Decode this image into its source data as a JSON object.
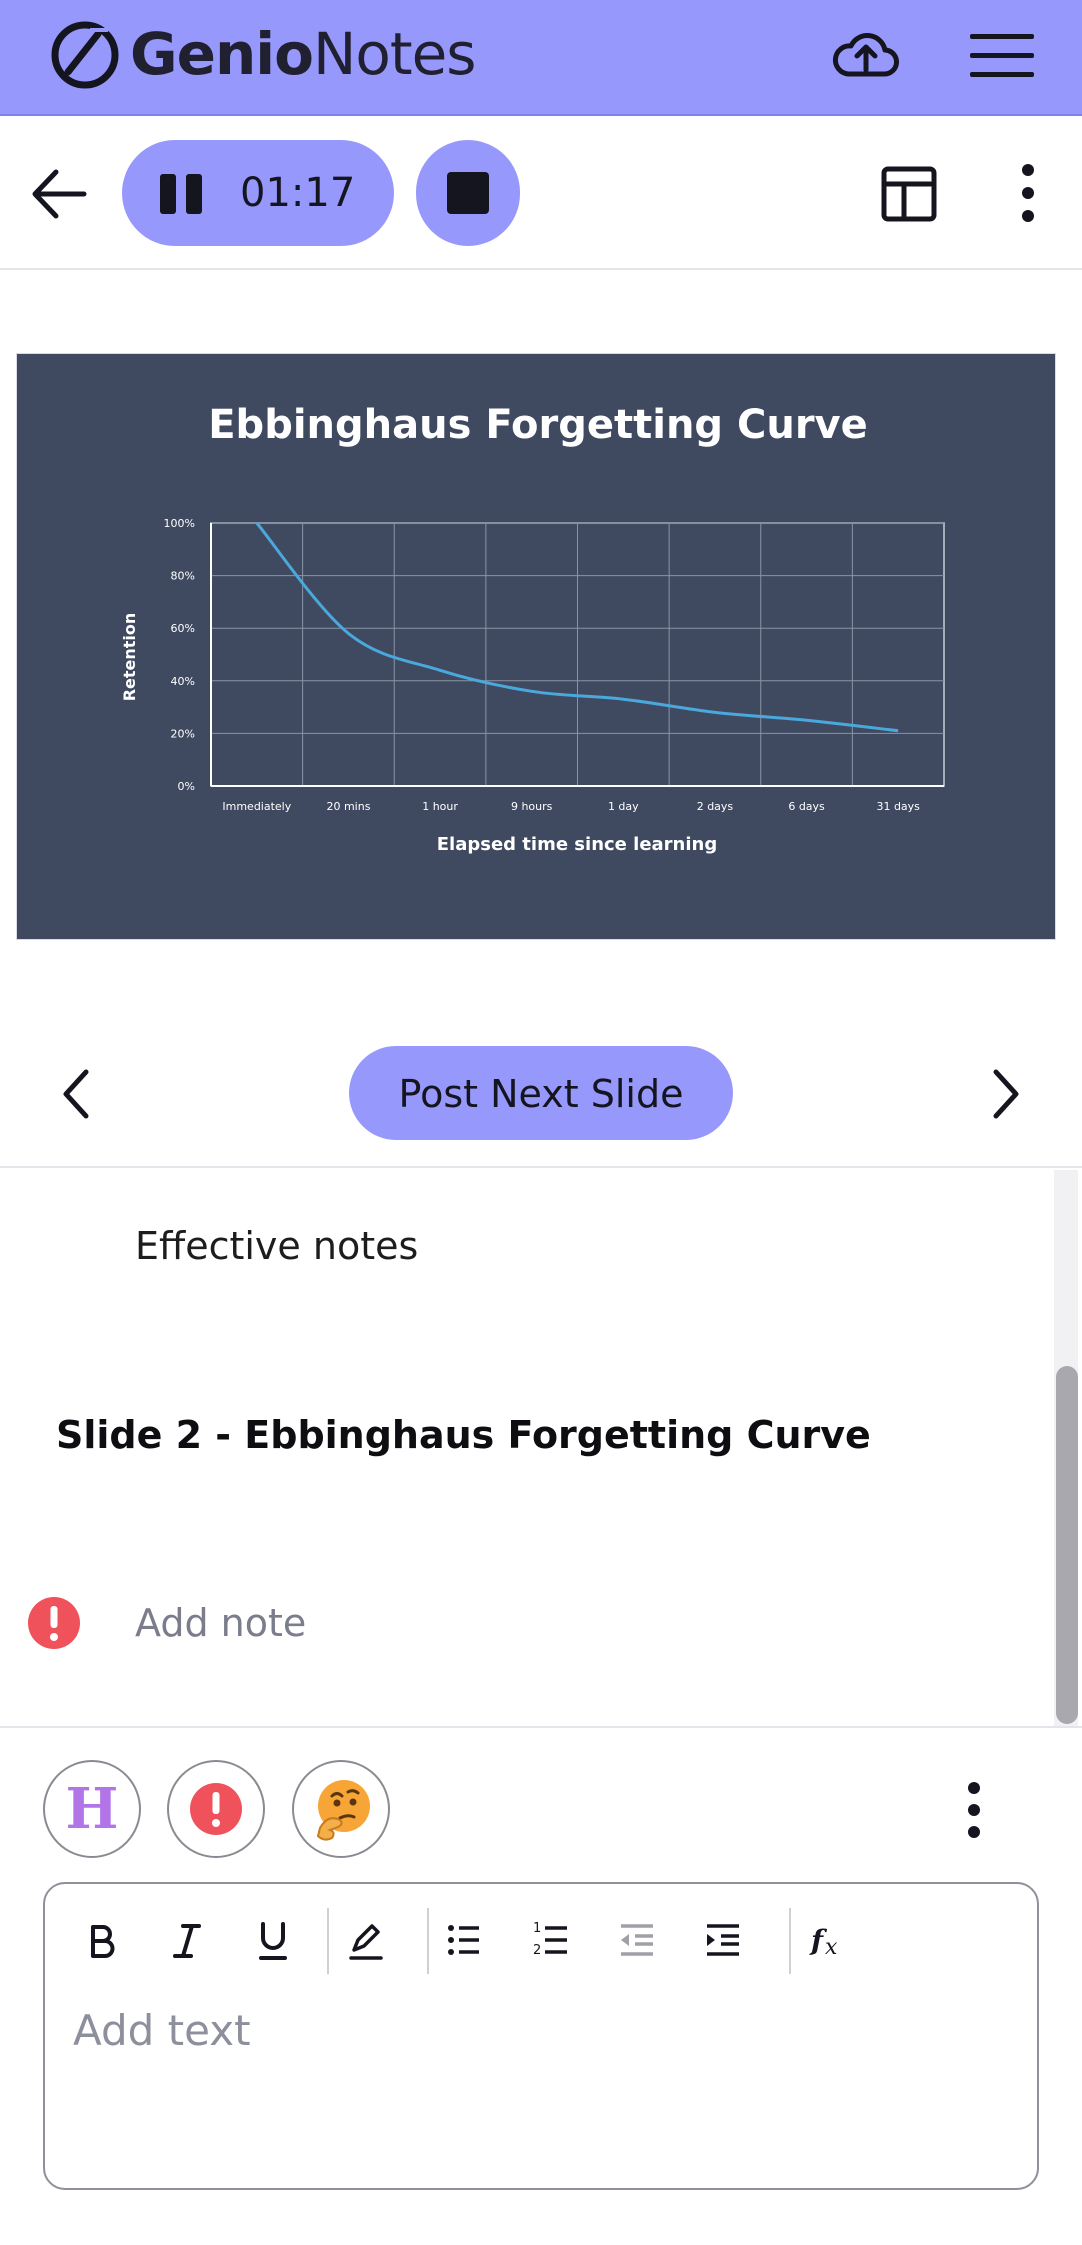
{
  "app": {
    "name_bold": "Genio",
    "name_light": "Notes",
    "brand_color": "#9699fb"
  },
  "recorder": {
    "elapsed": "01:17",
    "state": "recording"
  },
  "slide": {
    "title": "Ebbinghaus Forgetting Curve",
    "background": "#3f4a61"
  },
  "chart_data": {
    "type": "line",
    "title": "Ebbinghaus Forgetting Curve",
    "xlabel": "Elapsed time since learning",
    "ylabel": "Retention",
    "categories": [
      "Immediately",
      "20 mins",
      "1 hour",
      "9 hours",
      "1 day",
      "2 days",
      "6 days",
      "31 days"
    ],
    "y_ticks": [
      "0%",
      "20%",
      "40%",
      "60%",
      "80%",
      "100%"
    ],
    "ylim": [
      0,
      100
    ],
    "series": [
      {
        "values": [
          100,
          58,
          44,
          36,
          33,
          28,
          25,
          21
        ]
      }
    ],
    "grid": true,
    "line_color": "#4aa8dc"
  },
  "nav": {
    "post_next_label": "Post Next Slide"
  },
  "notes": {
    "heading": "Effective notes",
    "slide_title": "Slide 2 - Ebbinghaus Forgetting Curve",
    "add_note_placeholder": "Add note"
  },
  "editor": {
    "tags": [
      {
        "icon": "heading-h-icon",
        "letter": "H"
      },
      {
        "icon": "alert-icon"
      },
      {
        "icon": "thinking-face-icon"
      }
    ],
    "toolbar": [
      "bold",
      "italic",
      "underline",
      "highlight",
      "bulleted-list",
      "numbered-list",
      "outdent",
      "indent",
      "formula"
    ],
    "placeholder": "Add text"
  }
}
